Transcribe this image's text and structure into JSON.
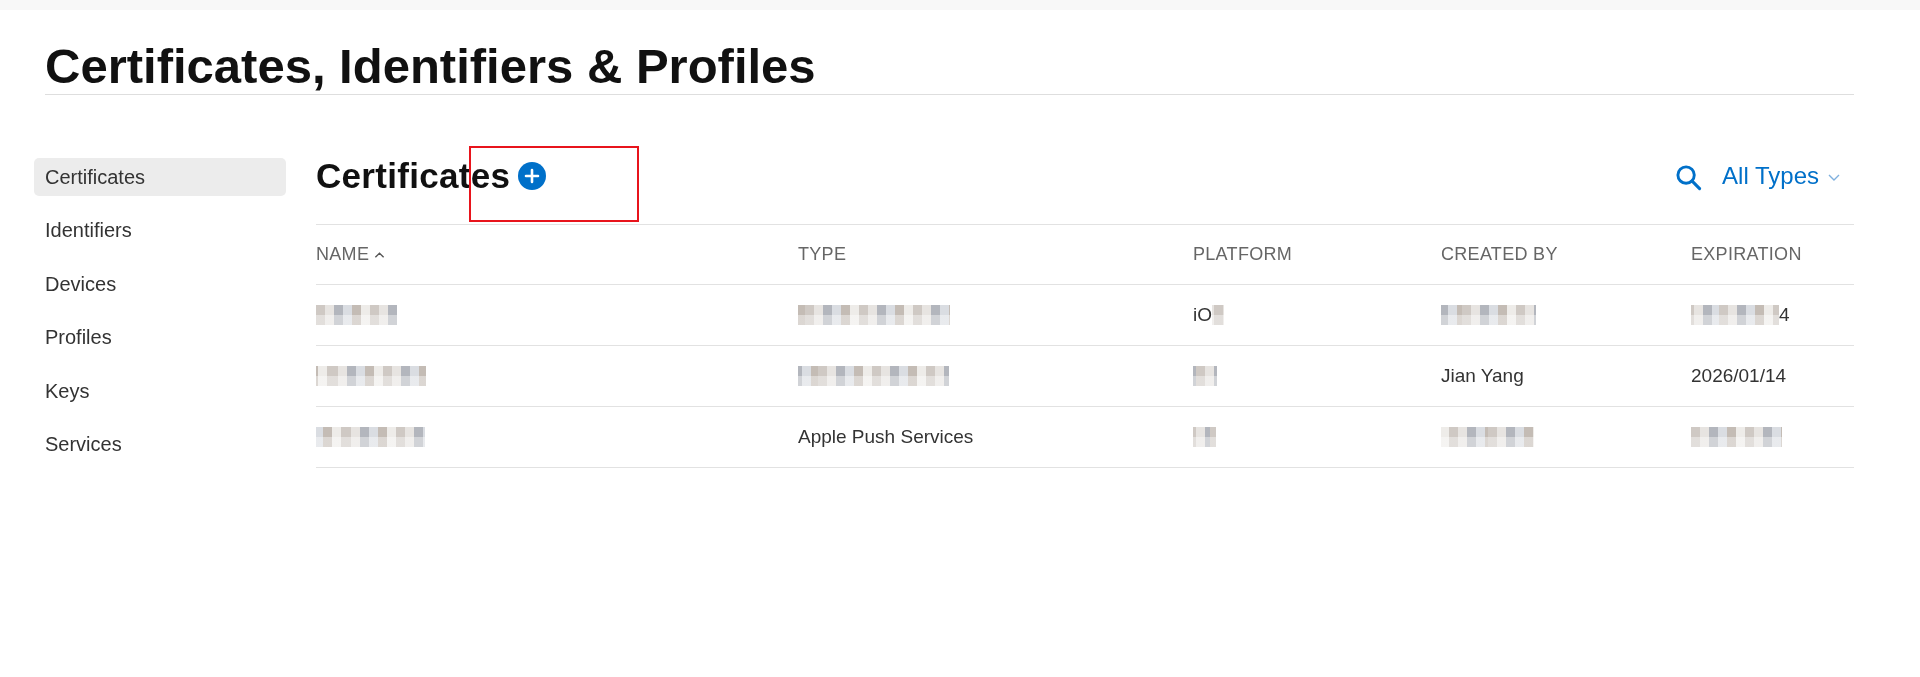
{
  "page": {
    "title": "Certificates, Identifiers & Profiles"
  },
  "sidebar": {
    "items": [
      {
        "label": "Certificates",
        "selected": true
      },
      {
        "label": "Identifiers",
        "selected": false
      },
      {
        "label": "Devices",
        "selected": false
      },
      {
        "label": "Profiles",
        "selected": false
      },
      {
        "label": "Keys",
        "selected": false
      },
      {
        "label": "Services",
        "selected": false
      }
    ]
  },
  "content": {
    "title": "Certificates",
    "add_button": {
      "highlighted": true
    },
    "filter": {
      "label": "All Types"
    },
    "table": {
      "columns": [
        {
          "label": "NAME",
          "sorted": true
        },
        {
          "label": "TYPE",
          "sorted": false
        },
        {
          "label": "PLATFORM",
          "sorted": false
        },
        {
          "label": "CREATED BY",
          "sorted": false
        },
        {
          "label": "EXPIRATION",
          "sorted": false
        }
      ],
      "rows": [
        {
          "cells": [
            {
              "kind": "redacted"
            },
            {
              "kind": "redacted"
            },
            {
              "kind": "text_then_redacted",
              "text": "iO"
            },
            {
              "kind": "redacted"
            },
            {
              "kind": "redacted_then_text",
              "text": "4"
            }
          ]
        },
        {
          "cells": [
            {
              "kind": "redacted"
            },
            {
              "kind": "redacted"
            },
            {
              "kind": "redacted"
            },
            {
              "kind": "text",
              "text": "Jian Yang"
            },
            {
              "kind": "text",
              "text": "2026/01/14"
            }
          ]
        },
        {
          "cells": [
            {
              "kind": "redacted"
            },
            {
              "kind": "text",
              "text": "Apple Push Services"
            },
            {
              "kind": "redacted"
            },
            {
              "kind": "redacted"
            },
            {
              "kind": "redacted"
            }
          ]
        }
      ]
    }
  }
}
